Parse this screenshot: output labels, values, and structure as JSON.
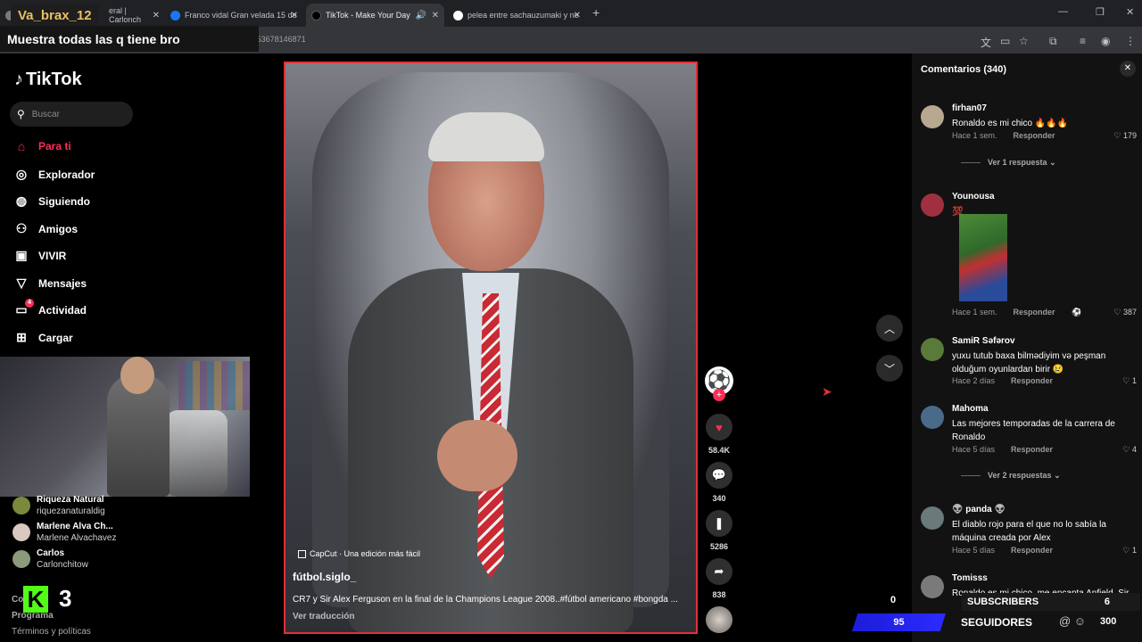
{
  "browser": {
    "tabs": [
      {
        "title": "eral | Carlonch"
      },
      {
        "title": "Franco vidal Gran velada 15 de"
      },
      {
        "title": "TikTok - Make Your Day"
      },
      {
        "title": "pelea entre sachauzumaki y ne"
      }
    ],
    "url": "tury_/video/7602173536781468",
    "url_tail": "71",
    "new_tab": "+"
  },
  "overlay": {
    "streamer": "Va_brax_12",
    "message": "Muestra todas las q tiene bro"
  },
  "sidebar": {
    "logo": "TikTok",
    "search_placeholder": "Buscar",
    "nav": [
      {
        "label": "Para ti",
        "icon": "home-icon"
      },
      {
        "label": "Explorador",
        "icon": "compass-icon"
      },
      {
        "label": "Siguiendo",
        "icon": "avatar-icon"
      },
      {
        "label": "Amigos",
        "icon": "friends-icon"
      },
      {
        "label": "VIVIR",
        "icon": "live-icon"
      },
      {
        "label": "Mensajes",
        "icon": "send-icon"
      },
      {
        "label": "Actividad",
        "icon": "activity-icon",
        "badge": "4"
      },
      {
        "label": "Cargar",
        "icon": "upload-icon"
      }
    ],
    "following": [
      {
        "name": "Riqueza Natural",
        "user": "riquezanaturaldig"
      },
      {
        "name": "Marlene Alva Ch...",
        "user": "Marlene Alvachavez"
      },
      {
        "name": "Carlos",
        "user": "Carlonchitow"
      }
    ],
    "footer": [
      "Compa",
      "Programa",
      "Términos y políticas"
    ],
    "kick_count": "3"
  },
  "video": {
    "capcut": "CapCut · Una edición más fácil",
    "author": "fútbol.siglo_",
    "description": "CR7 y Sir Alex Ferguson en la final de la Champions League 2008..#fútbol americano #bongda ...",
    "translate": "Ver traducción"
  },
  "actions": {
    "likes": "58.4K",
    "comments": "340",
    "saves": "5286",
    "shares": "838"
  },
  "comments": {
    "header": "Comentarios",
    "count": "(340)",
    "reply_label": "Responder",
    "items": [
      {
        "user": "firhan07",
        "text": "Ronaldo es mi chico 🔥🔥🔥",
        "time": "Hace 1 sem.",
        "likes": "179",
        "replies": "Ver 1 respuesta"
      },
      {
        "user": "Younousa",
        "text": "💯",
        "time": "Hace 1 sem.",
        "likes": "387"
      },
      {
        "user": "SamiR Səfərov",
        "text": "yuxu tutub baxa bilmədiyim və peşman olduğum oyunlardan birir 😢",
        "time": "Hace 2 días",
        "likes": "1"
      },
      {
        "user": "Mahoma",
        "text": "Las mejores temporadas de la carrera de Ronaldo",
        "time": "Hace 5 días",
        "likes": "4",
        "replies": "Ver 2 respuestas"
      },
      {
        "user": "👽 panda 👽",
        "text": "El diablo rojo para el que no lo sabía la máquina creada por Alex",
        "time": "Hace 5 días",
        "likes": "1"
      },
      {
        "user": "Tomisss",
        "text": "Ronaldo es mi chico, me encanta Anfield, Sir"
      }
    ]
  },
  "stream_counters": {
    "zero": "0",
    "subscribers_label": "SUBSCRIBERS",
    "subscribers_value": "6",
    "bar_value": "95",
    "followers_label": "SEGUIDORES",
    "followers_value": "300"
  },
  "colors": {
    "accent": "#fe2c55",
    "kick": "#53fc18",
    "video_border": "#e02f3a"
  }
}
